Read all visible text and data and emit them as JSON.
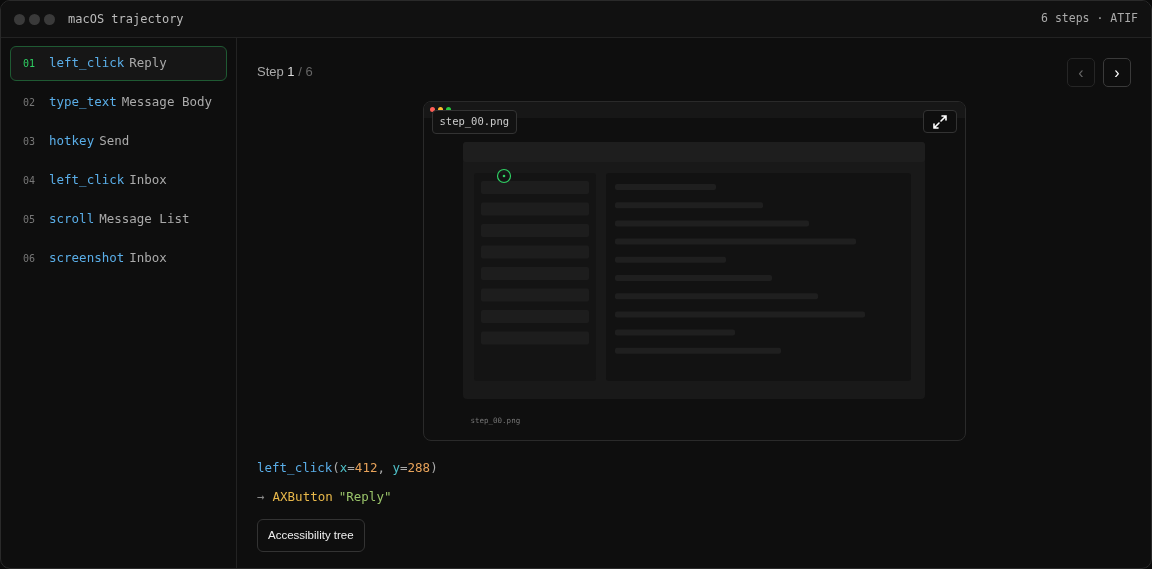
{
  "window": {
    "title": "macOS trajectory",
    "meta": "6 steps · ATIF"
  },
  "steps": [
    {
      "number": "01",
      "action": "left_click",
      "target": "Reply",
      "selected": true
    },
    {
      "number": "02",
      "action": "type_text",
      "target": "Message Body",
      "selected": false
    },
    {
      "number": "03",
      "action": "hotkey",
      "target": "Send",
      "selected": false
    },
    {
      "number": "04",
      "action": "left_click",
      "target": "Inbox",
      "selected": false
    },
    {
      "number": "05",
      "action": "scroll",
      "target": "Message List",
      "selected": false
    },
    {
      "number": "06",
      "action": "screenshot",
      "target": "Inbox",
      "selected": false
    }
  ],
  "step_header": {
    "label": "Step",
    "current": "1",
    "total": "/ 6"
  },
  "nav": [
    {
      "label": "‹",
      "disabled": true
    },
    {
      "label": "›",
      "disabled": false
    }
  ],
  "screenshot": {
    "filename": "step_00.png",
    "caption": "step_00.png"
  },
  "action_call": [
    {
      "text": "left_click",
      "kind": "fn"
    },
    {
      "text": "(",
      "kind": "punct"
    },
    {
      "text": "x",
      "kind": "key"
    },
    {
      "text": "=",
      "kind": "punct"
    },
    {
      "text": "412",
      "kind": "num"
    },
    {
      "text": ", ",
      "kind": "punct"
    },
    {
      "text": "y",
      "kind": "key"
    },
    {
      "text": "=",
      "kind": "punct"
    },
    {
      "text": "288",
      "kind": "num"
    },
    {
      "text": ")",
      "kind": "punct"
    }
  ],
  "result": [
    {
      "text": "→",
      "kind": "arrow"
    },
    {
      "text": "AXButton",
      "kind": "role"
    },
    {
      "text": "\"Reply\"",
      "kind": "str"
    }
  ],
  "button": "Accessibility tree"
}
